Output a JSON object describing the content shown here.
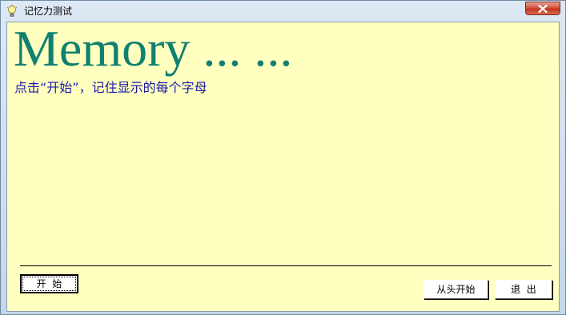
{
  "window": {
    "title": "记忆力测试",
    "title_icon": "lightbulb-icon",
    "close_icon": "close-icon"
  },
  "main": {
    "headline": "Memory ... ...",
    "instruction": "点击“开始”，记住显示的每个字母"
  },
  "buttons": {
    "start_label": "开  始",
    "restart_label": "从头开始",
    "exit_label": "退  出"
  },
  "colors": {
    "client_background": "#ffffc0",
    "headline": "#108070",
    "instruction": "#1a1aa8",
    "close_button": "#c0331d"
  }
}
